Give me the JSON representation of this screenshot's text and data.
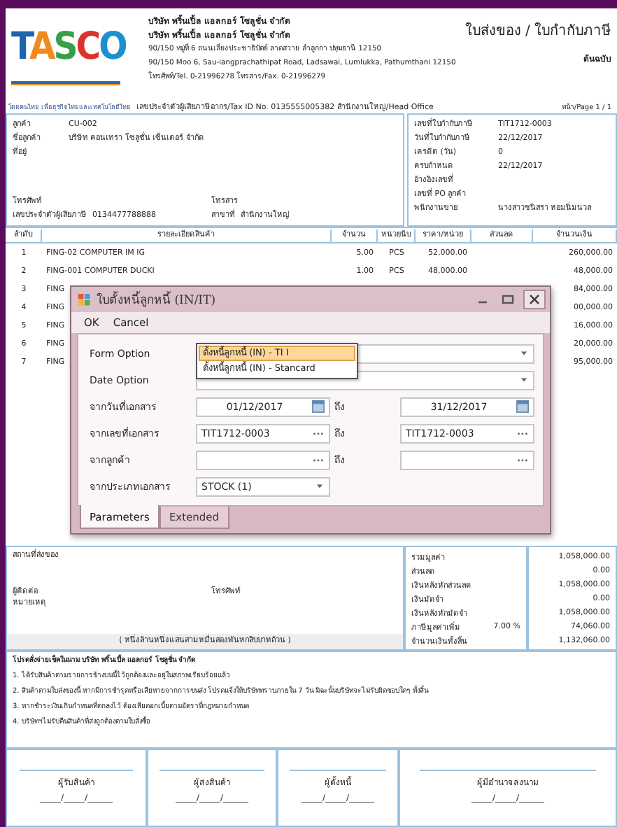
{
  "header": {
    "logo": "TASCO",
    "tagline": "โดยคนไทย เพื่อธุรกิจไทยและเทคโนโลยีไทย",
    "company_lines": [
      "บริษัท พริ้นเปิ้ล แอลกอร์ โซลูชั่น จำกัด",
      "บริษัท พริ้นเปิ้ล แอลกอร์ โซลูชั่น จำกัด",
      "90/150 หมู่ที่ 6 ถนนเลี่ยงประชาธิปัตย์ ลาดสวาย ลำลูกกา ปทุมธานี 12150",
      "90/150 Moo 6, Sau-iangprachathipat Road, Ladsawai, Lumlukka, Pathumthani 12150",
      "โทรศัพท์/Tel. 0-21996278 โทรสาร/Fax. 0-21996279"
    ],
    "tax_line": "เลขประจำตัวผู้เสียภาษีอากร/Tax ID No. 0135555005382 สำนักงานใหญ่/Head Office",
    "title": "ใบส่งของ / ใบกำกับภาษี",
    "copy_label": "ต้นฉบับ",
    "page": "หน้า/Page 1 / 1"
  },
  "customer": {
    "fields": [
      {
        "label": "ลูกค้า",
        "value": "CU-002"
      },
      {
        "label": "ชื่อลูกค้า",
        "value": "บริษัท คอนเทรา โซลูชั่น เซ็นเตอร์ จำกัด"
      },
      {
        "label": "ที่อยู่"
      }
    ],
    "contact_row": [
      {
        "label": "โทรศัพท์"
      },
      {
        "label": "โทรสาร"
      }
    ],
    "tax_row": [
      {
        "label": "เลขประจำตัวผู้เสียภาษี",
        "value": "0134477788888"
      },
      {
        "label": "สาขาที่",
        "value": "สำนักงานใหญ่"
      }
    ]
  },
  "invoice_info": [
    {
      "label": "เลขที่ใบกำกับภาษี",
      "value": "TIT1712-0003"
    },
    {
      "label": "วันที่ใบกำกับภาษี",
      "value": "22/12/2017"
    },
    {
      "label": "เครดิต (วัน)",
      "value": "0"
    },
    {
      "label": "ครบกำหนด",
      "value": "22/12/2017"
    },
    {
      "label": "อ้างอิงเลขที่"
    },
    {
      "label": "เลขที่ PO ลูกค้า"
    },
    {
      "label": "พนักงานขาย",
      "value": "นางสาวชนิสรา หอมนิ่มนวล"
    }
  ],
  "table": {
    "columns": [
      "ลำดับ",
      "รายละเอียดสินค้า",
      "จำนวน",
      "หน่วยนับ",
      "ราคา/หน่วย",
      "ส่วนลด",
      "จำนวนเงิน"
    ],
    "rows": [
      {
        "no": "1",
        "description": "FING-02  COMPUTER IM IG",
        "quantity": "5.00",
        "unit": "PCS",
        "price": "52,000.00",
        "amount": "260,000.00"
      },
      {
        "no": "2",
        "description": "FING-001  COMPUTER DUCKI",
        "quantity": "1.00",
        "unit": "PCS",
        "price": "48,000.00",
        "amount": "48,000.00"
      },
      {
        "no": "3",
        "description": "FING",
        "amount": "84,000.00"
      },
      {
        "no": "4",
        "description": "FING",
        "amount": "00,000.00"
      },
      {
        "no": "5",
        "description": "FING",
        "amount": "16,000.00"
      },
      {
        "no": "6",
        "description": "FING",
        "amount": "20,000.00"
      },
      {
        "no": "7",
        "description": "FING",
        "amount": "95,000.00"
      }
    ]
  },
  "delivery": {
    "place_label": "สถานที่ส่งของ",
    "contact_label": "ผู้ติดต่อ",
    "phone_label": "โทรศัพท์",
    "note_label": "หมายเหตุ",
    "amount_words": "( หนึ่งล้านหนึ่งแสนสามหมื่นสองพันหกสิบบาทถ้วน )"
  },
  "summary": [
    {
      "label": "รวมมูลค่า",
      "value": "1,058,000.00"
    },
    {
      "label": "ส่วนลด",
      "value": "0.00"
    },
    {
      "label": "เงินหลังหักส่วนลด",
      "value": "1,058,000.00"
    },
    {
      "label": "เงินมัดจำ",
      "value": "0.00"
    },
    {
      "label": "เงินหลังหักมัดจำ",
      "value": "1,058,000.00"
    },
    {
      "label": "ภาษีมูลค่าเพิ่ม",
      "rate": "7.00 %",
      "value": "74,060.00"
    },
    {
      "label": "จำนวนเงินทั้งสิ้น",
      "value": "1,132,060.00"
    }
  ],
  "notes": {
    "payee": "โปรดสั่งจ่ายเช็คในนาม  บริษัท พริ้นเปิ้ล แอลกอร์ โซลูชั่น จำกัด",
    "conditions": [
      "1. ได้รับสินค้าตามรายการข้างบนนี้ไว้ถูกต้องและอยู่ในสภาพเรียบร้อยแล้ว",
      "2. สินค้าตามใบส่งของนี้ หากมีการชำรุดหรือเสียหายจากการขนส่ง โปรดแจ้งให้บริษัททราบภายใน 7 วัน มิฉะนั้นบริษัทจะไม่รับผิดชอบใดๆ ทั้งสิ้น",
      "3. หากชำระเงินเกินกำหนดที่ตกลงไว้ ต้องเสียดอกเบี้ยตามอัตราที่กฎหมายกำหนด",
      "4. บริษัทฯไม่รับคืนสินค้าที่ส่งถูกต้องตามใบสั่งซื้อ"
    ]
  },
  "signatures": [
    {
      "label": "ผู้รับสินค้า",
      "date": "_____/_____/______"
    },
    {
      "label": "ผู้ส่งสินค้า",
      "date": "_____/_____/______"
    },
    {
      "label": "ผู้ตั้งหนี้",
      "date": "_____/_____/______"
    },
    {
      "label": "ผู้มีอำนาจลงนาม",
      "date": "_____/_____/______"
    }
  ],
  "dialog": {
    "title": "ใบตั้งหนี้ลูกหนี้ (IN/IT)",
    "menu": [
      "OK",
      "Cancel"
    ],
    "form": [
      {
        "kind": "combo",
        "label": "Form Option",
        "open": true,
        "options": [
          {
            "text": "ตั้งหนี้ลูกหนี้ (IN) - TI I",
            "selected": true
          },
          {
            "text": "ตั้งหนี้ลูกหนี้ (IN) - Stancard",
            "selected": false
          }
        ]
      },
      {
        "kind": "combo",
        "label": "Date Option",
        "open": false
      },
      {
        "kind": "date_range",
        "label": "จากวันที่เอกสาร",
        "from": "01/12/2017",
        "to_label": "ถึง",
        "to": "31/12/2017"
      },
      {
        "kind": "lookup_range",
        "label": "จากเลขที่เอกสาร",
        "from": "TIT1712-0003",
        "to_label": "ถึง",
        "to": "TIT1712-0003"
      },
      {
        "kind": "lookup_range",
        "label": "จากลูกค้า",
        "to_label": "ถึง"
      },
      {
        "kind": "select",
        "label": "จากประเภทเอกสาร",
        "value": "STOCK (1)"
      }
    ],
    "tabs": [
      {
        "label": "Parameters",
        "selected": true
      },
      {
        "label": "Extended",
        "selected": false
      }
    ]
  }
}
